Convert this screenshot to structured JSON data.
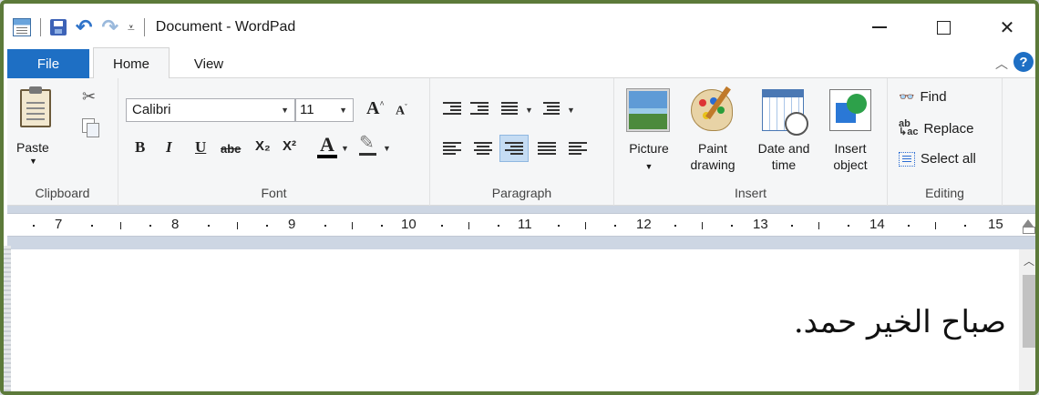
{
  "window": {
    "title": "Document - WordPad",
    "minimize": "—",
    "maximize": "☐",
    "close": "✕"
  },
  "tabs": {
    "file": "File",
    "home": "Home",
    "view": "View",
    "help": "?"
  },
  "clipboard": {
    "paste": "Paste",
    "group_label": "Clipboard"
  },
  "font": {
    "family": "Calibri",
    "size": "11",
    "grow_label": "A",
    "shrink_label": "A",
    "bold": "B",
    "italic": "I",
    "underline": "U",
    "strike": "abe",
    "subscript": "X₂",
    "superscript": "X²",
    "font_color": "A",
    "group_label": "Font"
  },
  "paragraph": {
    "group_label": "Paragraph",
    "active_align": "right"
  },
  "insert": {
    "picture": "Picture",
    "paint_line1": "Paint",
    "paint_line2": "drawing",
    "date_line1": "Date and",
    "date_line2": "time",
    "object_line1": "Insert",
    "object_line2": "object",
    "group_label": "Insert"
  },
  "editing": {
    "find": "Find",
    "replace": "Replace",
    "select_all": "Select all",
    "group_label": "Editing"
  },
  "ruler": {
    "numbers": [
      "7",
      "8",
      "9",
      "10",
      "11",
      "12",
      "13",
      "14",
      "15"
    ]
  },
  "document": {
    "text": "صباح الخير حمد."
  },
  "icons": {
    "app": "wordpad-icon",
    "save": "save-icon",
    "undo": "undo-icon",
    "redo": "redo-icon",
    "cut": "scissors-icon",
    "copy": "copy-icon",
    "find": "binoculars-icon"
  },
  "colors": {
    "file_tab": "#1e6fc4",
    "frame": "#5c7a3a",
    "ribbon": "#f5f6f7"
  }
}
